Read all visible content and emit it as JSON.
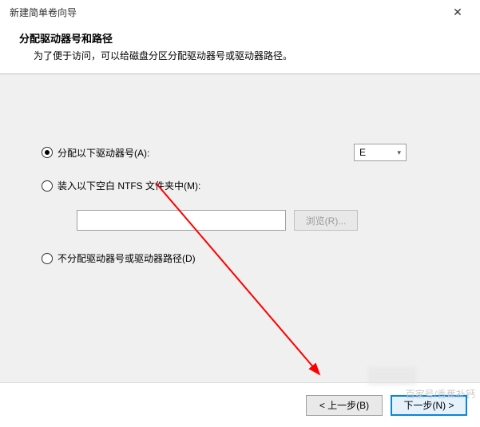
{
  "window": {
    "title": "新建简单卷向导"
  },
  "header": {
    "title": "分配驱动器号和路径",
    "desc": "为了便于访问，可以给磁盘分区分配驱动器号或驱动器路径。"
  },
  "options": {
    "assign": {
      "label": "分配以下驱动器号(A):",
      "drive": "E"
    },
    "mount": {
      "label": "装入以下空白 NTFS 文件夹中(M):",
      "path": "",
      "browse": "浏览(R)..."
    },
    "none": {
      "label": "不分配驱动器号或驱动器路径(D)"
    }
  },
  "footer": {
    "back": "< 上一步(B)",
    "next": "下一步(N) >"
  },
  "watermark": "百家号/香蕉补钙"
}
